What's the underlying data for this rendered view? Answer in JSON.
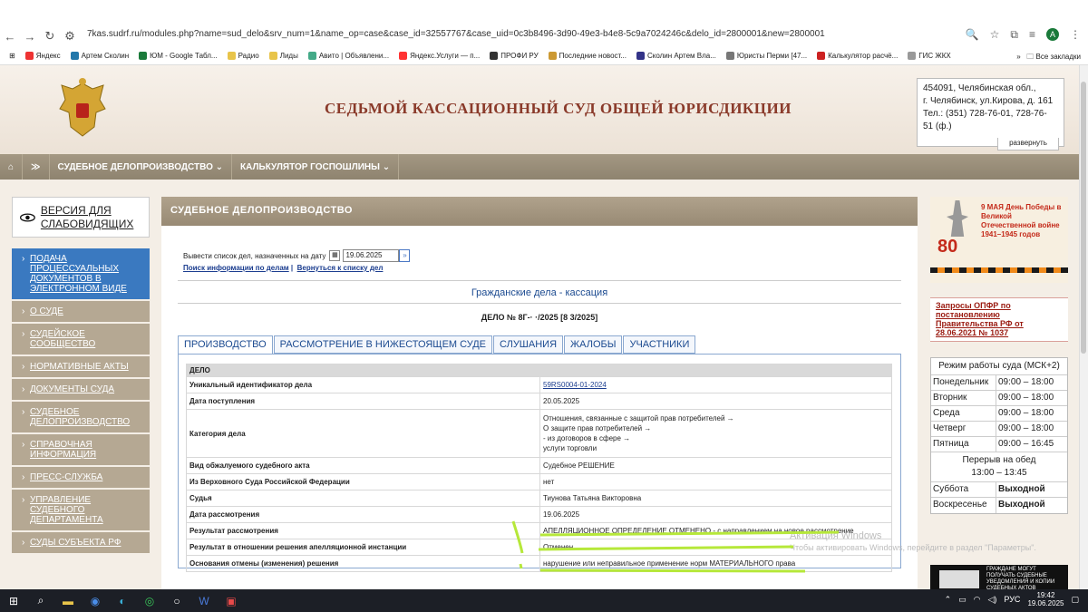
{
  "browser": {
    "url": "7kas.sudrf.ru/modules.php?name=sud_delo&srv_num=1&name_op=case&case_id=32557767&case_uid=0c3b8496-3d90-49e3-b4e8-5c9a7024246c&delo_id=2800001&new=2800001",
    "profile_letter": "A",
    "bookmarks": [
      "Яндекс",
      "Артем Сколин",
      "ЮМ - Google Табл...",
      "Радио",
      "Лиды",
      "Авито | Объявлени...",
      "Яндекс.Услуги — п...",
      "ПРОФИ РУ",
      "Последние новост...",
      "Сколин Артем Вла...",
      "Юристы Перми [47...",
      "Калькулятор расчё...",
      "ГИС ЖКХ"
    ],
    "all_bookmarks": "Все закладки"
  },
  "site": {
    "court_name": "СЕДЬМОЙ КАССАЦИОННЫЙ СУД ОБЩЕЙ ЮРИСДИКЦИИ",
    "address_lines": [
      "454091, Челябинская обл.,",
      "г. Челябинск, ул.Кирова, д. 161",
      "Тел.: (351) 728-76-01, 728-76-",
      "51 (ф.)"
    ],
    "expand_label": "развернуть",
    "nav": [
      "СУДЕБНОЕ ДЕЛОПРОИЗВОДСТВО",
      "КАЛЬКУЛЯТОР ГОСПОШЛИНЫ"
    ],
    "low_vision": "ВЕРСИЯ ДЛЯ СЛАБОВИДЯЩИХ",
    "menu": [
      "ПОДАЧА ПРОЦЕССУАЛЬНЫХ ДОКУМЕНТОВ В ЭЛЕКТРОННОМ ВИДЕ",
      "О СУДЕ",
      "СУДЕЙСКОЕ СООБЩЕСТВО",
      "НОРМАТИВНЫЕ АКТЫ",
      "ДОКУМЕНТЫ СУДА",
      "СУДЕБНОЕ ДЕЛОПРОИЗВОДСТВО",
      "СПРАВОЧНАЯ ИНФОРМАЦИЯ",
      "ПРЕСС-СЛУЖБА",
      "УПРАВЛЕНИЕ СУДЕБНОГО ДЕПАРТАМЕНТА",
      "СУДЫ СУБЪЕКТА РФ"
    ]
  },
  "panel": {
    "title": "СУДЕБНОЕ ДЕЛОПРОИЗВОДСТВО",
    "date_label": "Вывести список дел, назначенных на дату",
    "date_value": "19.06.2025",
    "link_search": "Поиск информации по делам",
    "link_back": "Вернуться к списку дел",
    "case_type": "Гражданские дела - кассация",
    "case_number": "ДЕЛО № 8Г-·    ·/2025 [8     3/2025]",
    "tabs": [
      "ПРОИЗВОДСТВО",
      "РАССМОТРЕНИЕ В НИЖЕСТОЯЩЕМ СУДЕ",
      "СЛУШАНИЯ",
      "ЖАЛОБЫ",
      "УЧАСТНИКИ"
    ],
    "table_header": "ДЕЛО",
    "rows": [
      {
        "k": "Уникальный идентификатор дела",
        "v": "59RS0004-01-2024"
      },
      {
        "k": "Дата поступления",
        "v": "20.05.2025"
      },
      {
        "k": "Категория дела",
        "v": "Отношения, связанные с защитой прав потребителей →\nО защите прав потребителей →\n- из договоров в сфере →\nуслуги торговли"
      },
      {
        "k": "Вид обжалуемого судебного акта",
        "v": "Судебное РЕШЕНИЕ"
      },
      {
        "k": "Из Верховного Суда Российской Федерации",
        "v": "нет"
      },
      {
        "k": "Судья",
        "v": "Тиунова Татьяна Викторовна"
      },
      {
        "k": "Дата рассмотрения",
        "v": "19.06.2025"
      },
      {
        "k": "Результат рассмотрения",
        "v": "АПЕЛЛЯЦИОННОЕ ОПРЕДЕЛЕНИЕ ОТМЕНЕНО - с направлением на новое рассмотрение"
      },
      {
        "k": "Результат в отношении решения апелляционной инстанции",
        "v": "Отменен"
      },
      {
        "k": "Основания отмены (изменения) решения",
        "v": "нарушение или неправильное применение норм МАТЕРИАЛЬНОГО права"
      }
    ]
  },
  "right": {
    "banner_80": "80",
    "banner_text": "9 МАЯ День Победы в Великой Отечественной войне 1941–1945 годов",
    "opfr": "Запросы ОПФР по постановлению Правительства РФ от 28.06.2021 № 1037",
    "hours_title": "Режим работы суда (МСК+2)",
    "hours": [
      [
        "Понедельник",
        "09:00 – 18:00"
      ],
      [
        "Вторник",
        "09:00 – 18:00"
      ],
      [
        "Среда",
        "09:00 – 18:00"
      ],
      [
        "Четверг",
        "09:00 – 18:00"
      ],
      [
        "Пятница",
        "09:00 – 16:45"
      ]
    ],
    "break_label": "Перерыв на обед",
    "break_time": "13:00 – 13:45",
    "weekend": [
      [
        "Суббота",
        "Выходной"
      ],
      [
        "Воскресенье",
        "Выходной"
      ]
    ],
    "notice": "ГРАЖДАНЕ МОГУТ ПОЛУЧАТЬ СУДЕБНЫЕ УВЕДОМЛЕНИЯ И КОПИИ СУДЕБНЫХ АКТОВ"
  },
  "watermark": {
    "line1": "Активация Windows",
    "line2": "Чтобы активировать Windows, перейдите в раздел \"Параметры\"."
  },
  "taskbar": {
    "lang": "РУС",
    "time": "19:42",
    "date": "19.06.2025"
  },
  "colors": {
    "menu": "#b5a893",
    "menu_active": "#3a79c0",
    "nav": "#988a74",
    "court_title": "#8a3a2a",
    "annotation": "#b6e83a"
  }
}
